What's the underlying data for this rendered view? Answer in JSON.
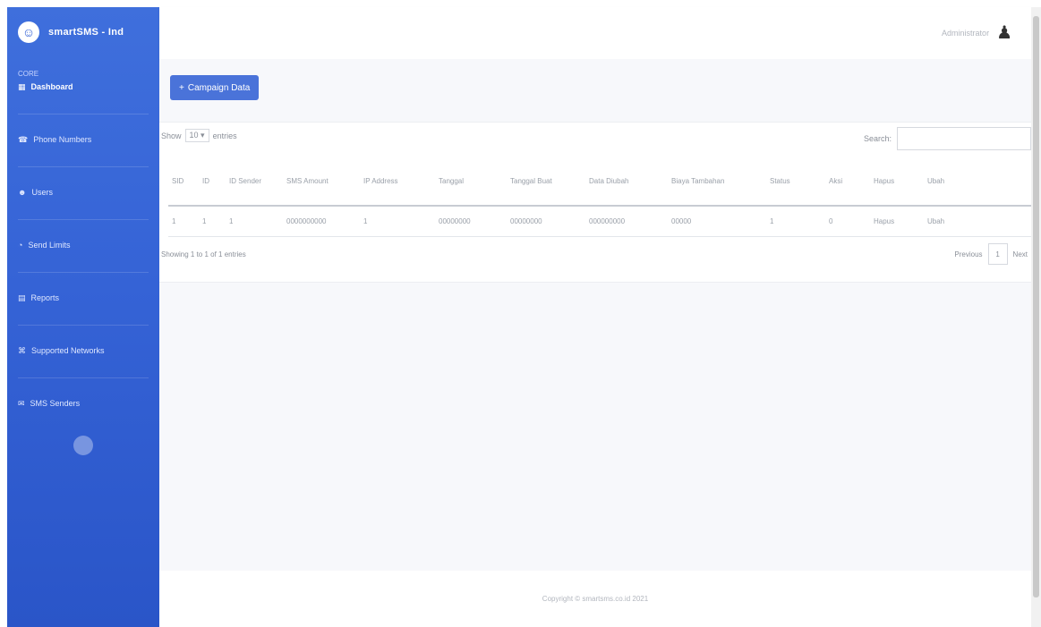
{
  "brand": {
    "logo": "smiley-logo",
    "name": "smartSMS - Ind"
  },
  "sidebar": {
    "heading": "CORE",
    "items": [
      {
        "label": "Dashboard",
        "icon": "dashboard-icon",
        "active": true
      },
      {
        "label": "Phone Numbers",
        "icon": "phone-icon",
        "active": false
      },
      {
        "label": "Users",
        "icon": "users-icon",
        "active": false
      },
      {
        "label": "Send Limits",
        "icon": "limits-icon",
        "active": false
      },
      {
        "label": "Reports",
        "icon": "reports-icon",
        "active": false
      },
      {
        "label": "Supported Networks",
        "icon": "network-icon",
        "active": false
      },
      {
        "label": "SMS Senders",
        "icon": "sender-icon",
        "active": false
      }
    ]
  },
  "topbar": {
    "user_name": "Administrator",
    "user_icon": "user-icon"
  },
  "toolbar": {
    "add_button_icon": "+",
    "add_button_label": "Campaign Data"
  },
  "table_controls": {
    "show_label": "Show",
    "show_value": "10",
    "entries_label": "entries",
    "search_label": "Search:",
    "search_value": ""
  },
  "table": {
    "columns": [
      "SID",
      "ID",
      "ID Sender",
      "SMS Amount",
      "IP Address",
      "Tanggal",
      "Tanggal Buat",
      "Data Diubah",
      "Biaya Tambahan",
      "Status",
      "Aksi",
      "Hapus",
      "Ubah"
    ],
    "rows": [
      [
        "1",
        "1",
        "1",
        "0000000000",
        "1",
        "00000000",
        "00000000",
        "000000000",
        "00000",
        "1",
        "0",
        "Hapus",
        "Ubah"
      ]
    ]
  },
  "pagination": {
    "info": "Showing 1 to 1 of 1 entries",
    "previous": "Previous",
    "current": "1",
    "next": "Next"
  },
  "footer": {
    "text": "Copyright © smartsms.co.id 2021"
  }
}
